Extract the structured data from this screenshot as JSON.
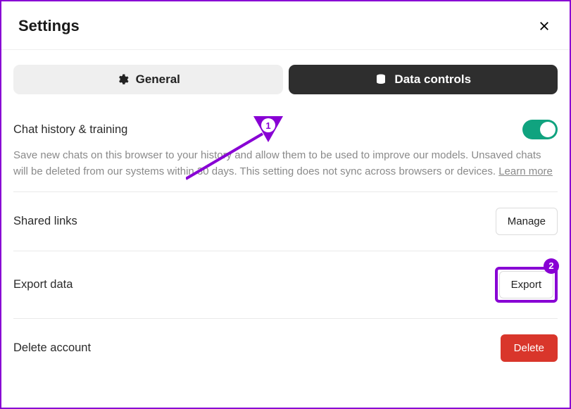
{
  "header": {
    "title": "Settings"
  },
  "tabs": {
    "general": "General",
    "data_controls": "Data controls"
  },
  "history": {
    "label": "Chat history & training",
    "description_pre": "Save new chats on this browser to your history and allow them to be used to improve our models. Unsaved chats will be deleted from our systems within 30 days. This setting does not sync across browsers or devices. ",
    "learn_more": "Learn more"
  },
  "shared_links": {
    "label": "Shared links",
    "button": "Manage"
  },
  "export": {
    "label": "Export data",
    "button": "Export"
  },
  "delete": {
    "label": "Delete account",
    "button": "Delete"
  },
  "callouts": {
    "one": "1",
    "two": "2"
  },
  "colors": {
    "accent": "#8800d4",
    "toggle_on": "#10a37f",
    "danger": "#d9362b"
  }
}
